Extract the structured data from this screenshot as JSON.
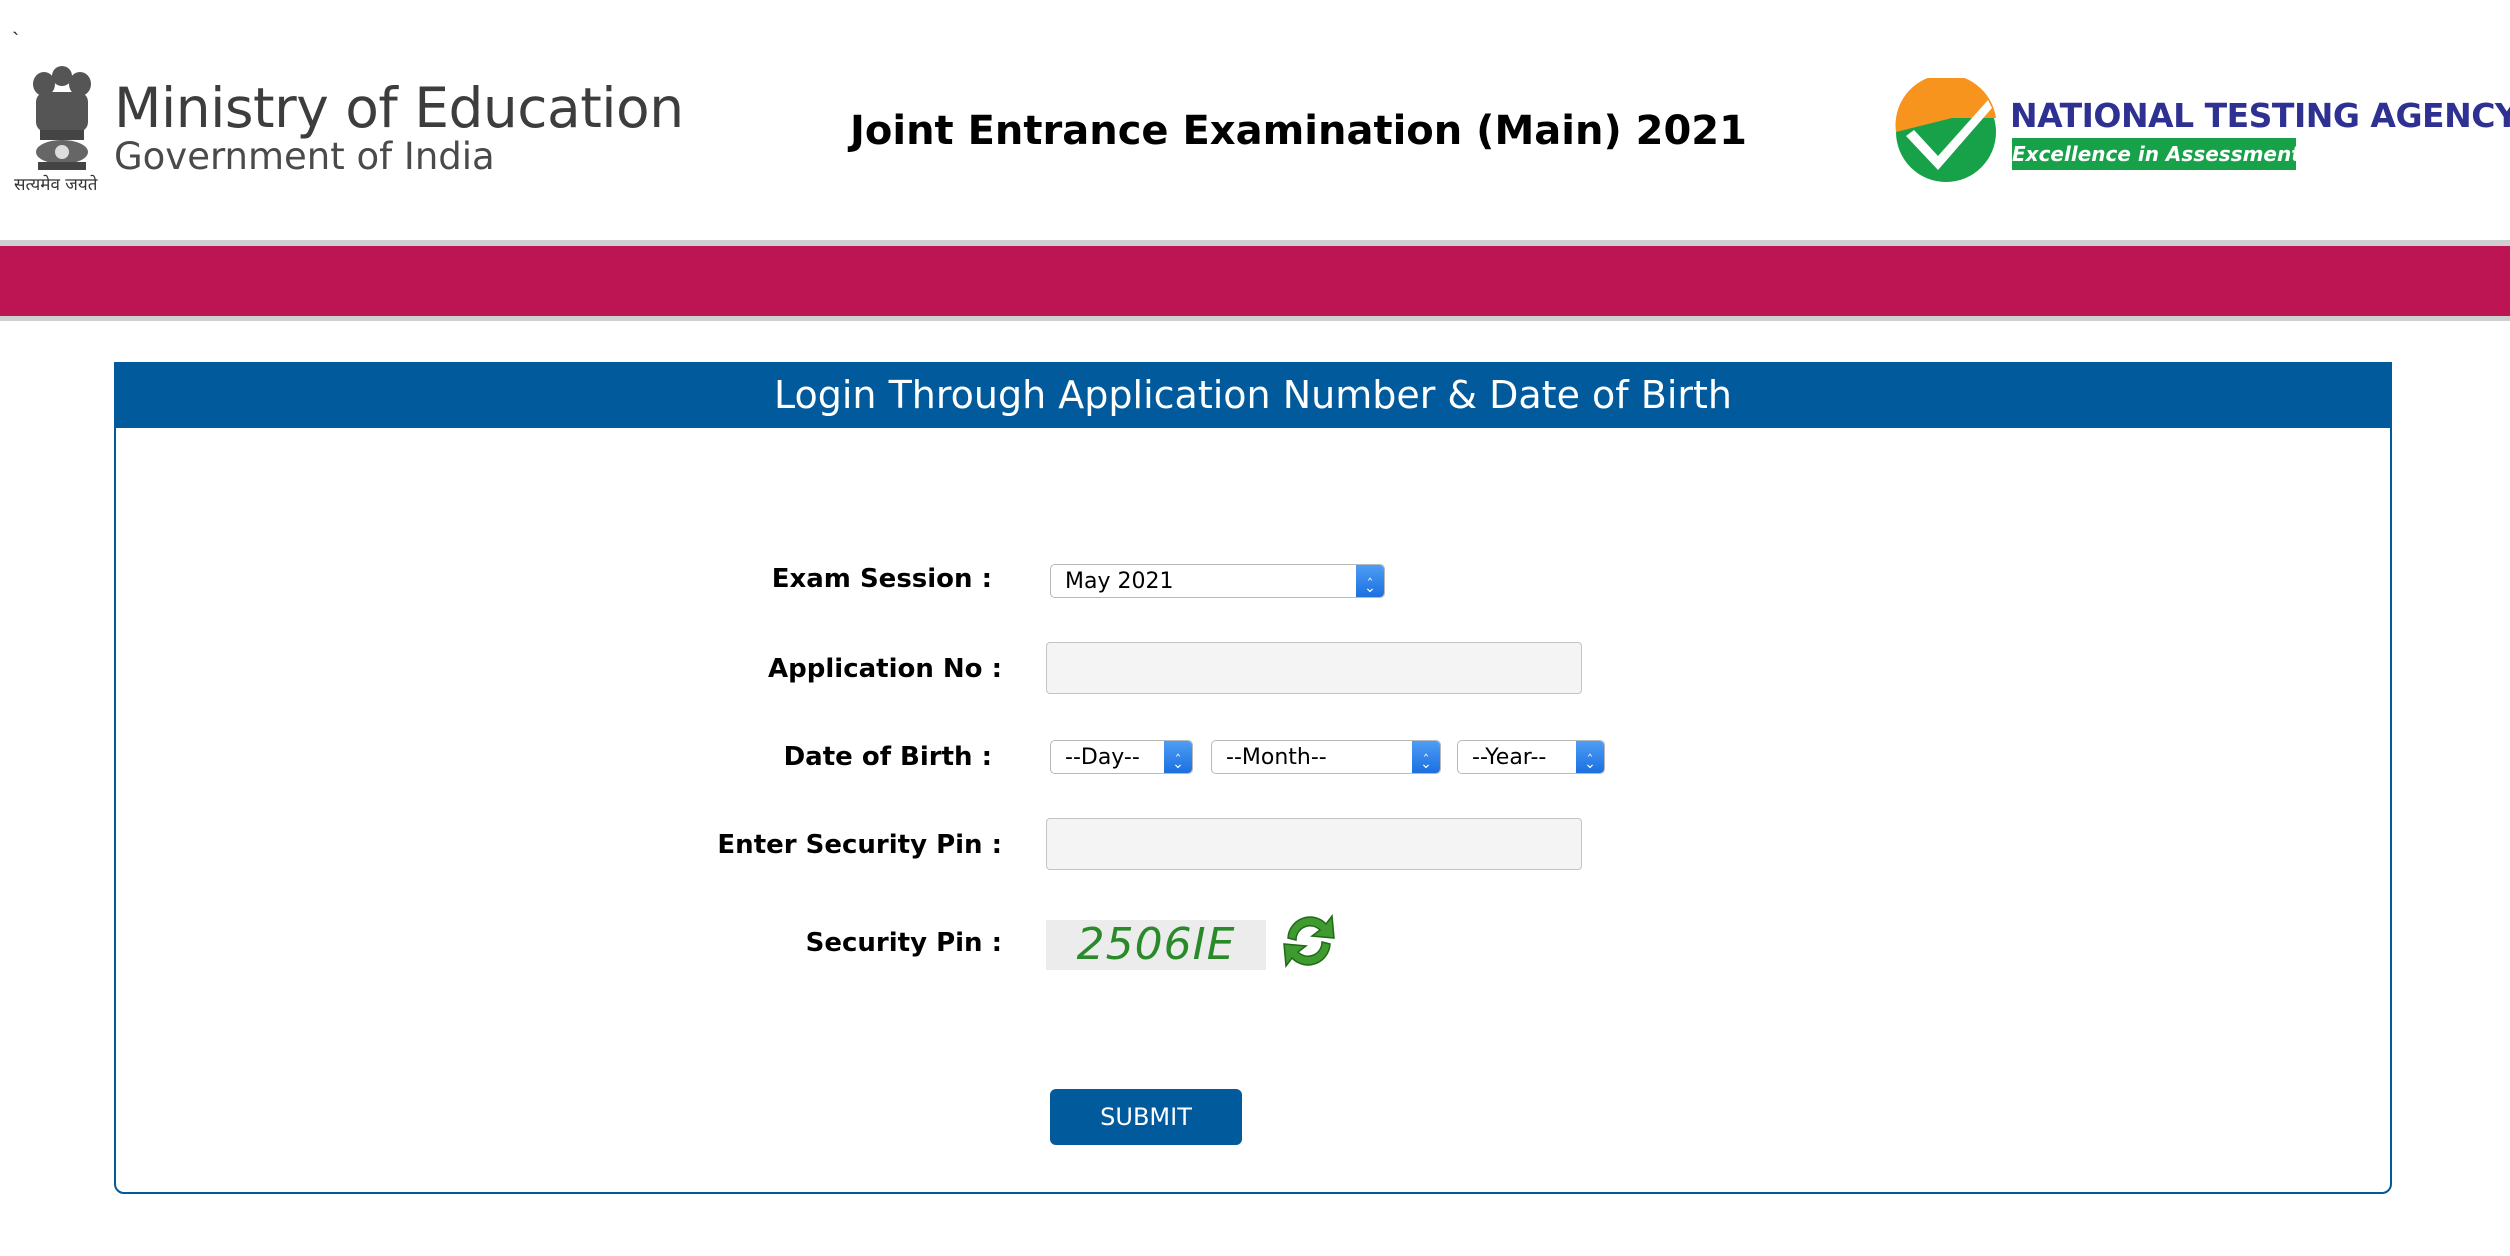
{
  "header": {
    "tick_mark": "`",
    "emblem_caption": "सत्यमेव जयते",
    "ministry_title": "Ministry of Education",
    "ministry_subtitle": "Government of India",
    "exam_title": "Joint Entrance Examination (Main) 2021",
    "agency_name": "NATIONAL TESTING AGENCY",
    "agency_tagline": "Excellence in Assessment"
  },
  "colors": {
    "band": "#bd1454",
    "panel_blue": "#005a9c",
    "agency_green": "#17a24a",
    "agency_blue": "#2e3192",
    "agency_orange": "#f7941d"
  },
  "form": {
    "heading": "Login Through Application Number & Date of Birth",
    "exam_session_label": "Exam Session :",
    "exam_session_value": "May 2021",
    "application_no_label": "Application No :",
    "application_no_value": "",
    "dob_label": "Date of Birth :",
    "dob_day": "--Day--",
    "dob_month": "--Month--",
    "dob_year": "--Year--",
    "enter_pin_label": "Enter Security Pin :",
    "enter_pin_value": "",
    "security_pin_label": "Security Pin :",
    "captcha_text": "2506IE",
    "submit_label": "SUBMIT"
  },
  "icons": {
    "refresh": "refresh-icon",
    "emblem": "national-emblem-icon",
    "agency_logo": "checkmark-logo-icon"
  }
}
